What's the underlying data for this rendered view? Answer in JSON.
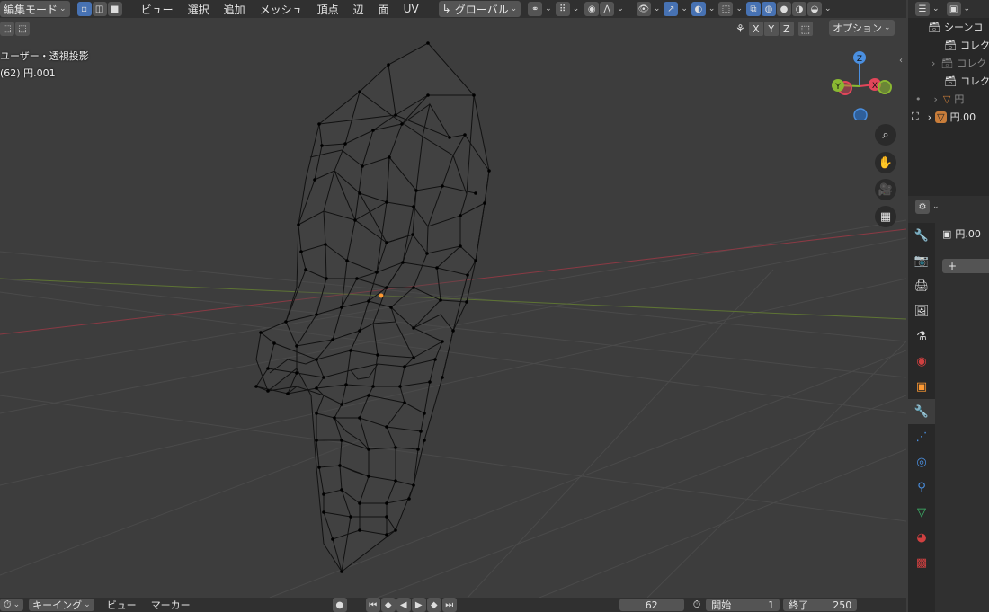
{
  "header": {
    "mode": "編集モード",
    "menus": [
      "ビュー",
      "選択",
      "追加",
      "メッシュ",
      "頂点",
      "辺",
      "面",
      "UV"
    ],
    "orientation": "グローバル",
    "xray_axes": [
      "X",
      "Y",
      "Z"
    ],
    "options": "オプション"
  },
  "viewport": {
    "view_label": "ユーザー・透視投影",
    "object_label": "(62) 円.001",
    "gizmo": {
      "z": "Z",
      "y": "Y",
      "x": "X"
    }
  },
  "outliner": {
    "items": [
      {
        "label": "シーンコ"
      },
      {
        "label": "コレク"
      },
      {
        "label": "コレク"
      },
      {
        "label": "コレク"
      },
      {
        "label": "円"
      },
      {
        "label": "円.00"
      }
    ]
  },
  "properties": {
    "object_name": "円.00",
    "add_label": "+"
  },
  "timeline": {
    "menus": [
      "キーイング",
      "ビュー",
      "マーカー"
    ],
    "current_frame": "62",
    "start_label": "開始",
    "start_value": "1",
    "end_label": "終了",
    "end_value": "250"
  },
  "colors": {
    "accent": "#4772b3",
    "x_axis": "#e2465a",
    "y_axis": "#8ab832",
    "z_axis": "#4a8fe0",
    "origin": "#ff9a33"
  }
}
